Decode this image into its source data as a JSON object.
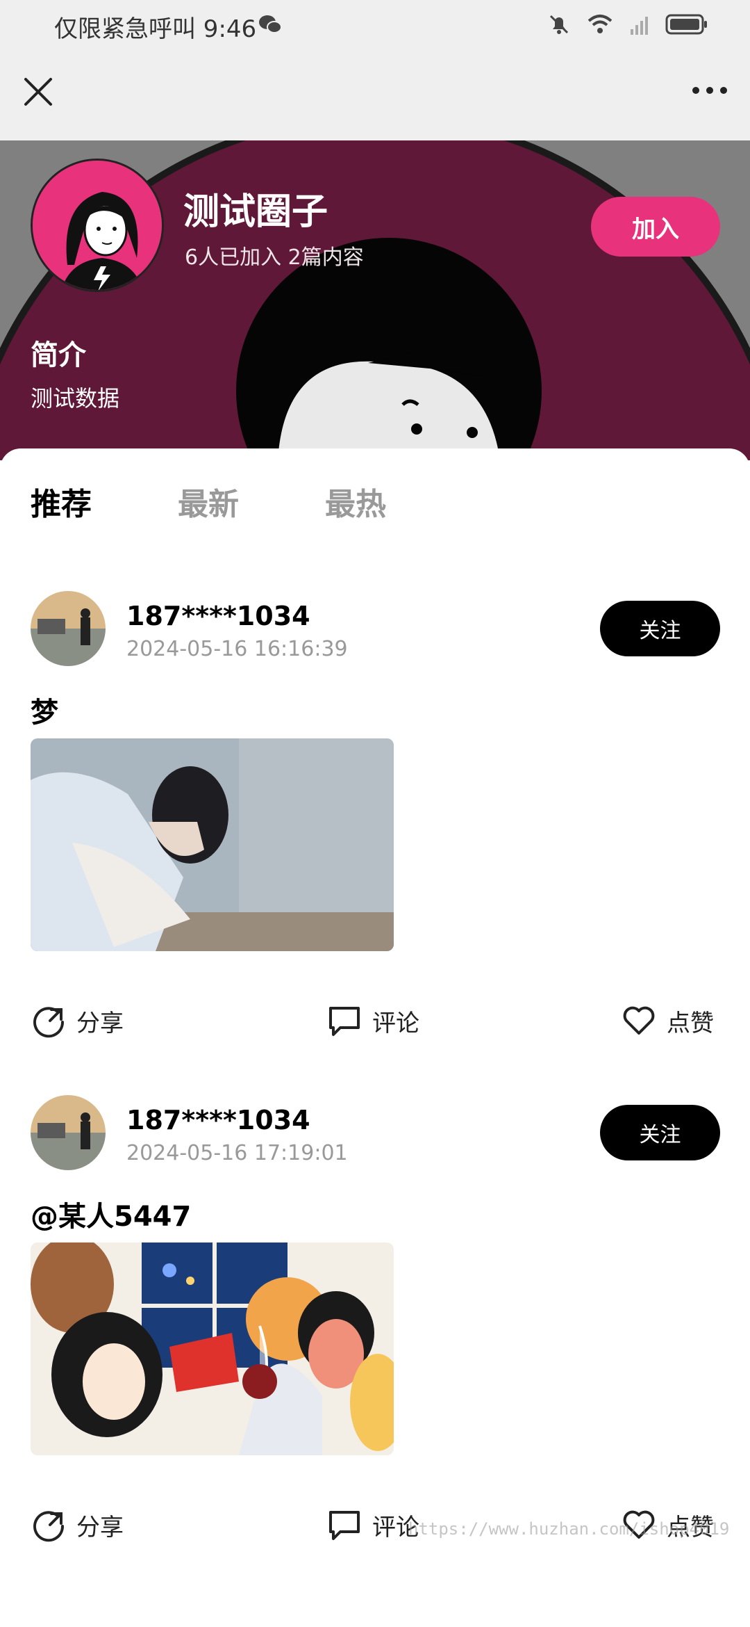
{
  "status_bar": {
    "text": "仅限紧急呼叫 9:46",
    "icons": [
      "wechat-icon",
      "bell-off-icon",
      "wifi-icon",
      "signal-icon",
      "battery-icon"
    ]
  },
  "nav": {
    "close_icon": "close-icon",
    "more_icon": "more-icon"
  },
  "circle": {
    "name": "测试圈子",
    "stats": "6人已加入 2篇内容",
    "join_label": "加入",
    "intro_title": "简介",
    "intro_text": "测试数据",
    "accent_color": "#e8327b"
  },
  "tabs": [
    {
      "label": "推荐",
      "active": true
    },
    {
      "label": "最新",
      "active": false
    },
    {
      "label": "最热",
      "active": false
    }
  ],
  "posts": [
    {
      "user": "187****1034",
      "time": "2024-05-16 16:16:39",
      "follow_label": "关注",
      "text": "梦",
      "actions": {
        "share": "分享",
        "comment": "评论",
        "like": "点赞"
      }
    },
    {
      "user": "187****1034",
      "time": "2024-05-16 17:19:01",
      "follow_label": "关注",
      "text": "@某人5447",
      "actions": {
        "share": "分享",
        "comment": "评论",
        "like": "点赞"
      }
    }
  ],
  "watermark": "https://www.huzhan.com/ishop4019"
}
